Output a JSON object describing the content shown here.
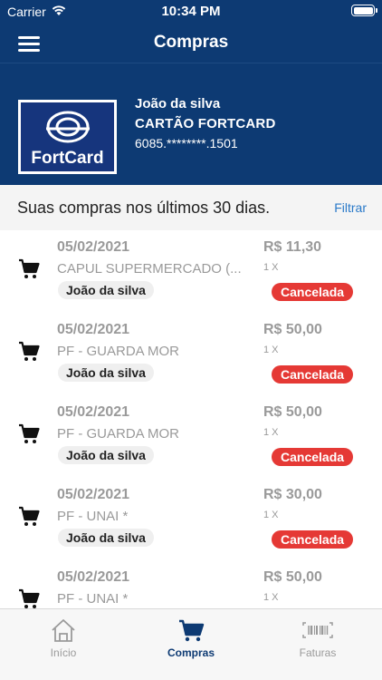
{
  "status_bar": {
    "carrier": "Carrier",
    "time": "10:34 PM"
  },
  "nav": {
    "title": "Compras"
  },
  "card": {
    "logo_text": "FortCard",
    "holder": "João da silva",
    "name": "CARTÃO FORTCARD",
    "number": "6085.********.1501"
  },
  "list_header": {
    "text": "Suas compras nos últimos 30 dias.",
    "filter_label": "Filtrar"
  },
  "purchases": [
    {
      "date": "05/02/2021",
      "merchant": "CAPUL SUPERMERCADO (...",
      "holder": "João da silva",
      "amount": "R$ 11,30",
      "installments": "1 X",
      "status": "Cancelada"
    },
    {
      "date": "05/02/2021",
      "merchant": "PF - GUARDA MOR",
      "holder": "João da silva",
      "amount": "R$ 50,00",
      "installments": "1 X",
      "status": "Cancelada"
    },
    {
      "date": "05/02/2021",
      "merchant": "PF - GUARDA MOR",
      "holder": "João da silva",
      "amount": "R$ 50,00",
      "installments": "1 X",
      "status": "Cancelada"
    },
    {
      "date": "05/02/2021",
      "merchant": "PF - UNAI *",
      "holder": "João da silva",
      "amount": "R$ 30,00",
      "installments": "1 X",
      "status": "Cancelada"
    },
    {
      "date": "05/02/2021",
      "merchant": "PF - UNAI *",
      "amount": "R$ 50,00",
      "installments": "1 X"
    }
  ],
  "tabs": [
    {
      "label": "Início",
      "icon": "home-icon",
      "active": false
    },
    {
      "label": "Compras",
      "icon": "cart-icon",
      "active": true
    },
    {
      "label": "Faturas",
      "icon": "barcode-icon",
      "active": false
    }
  ],
  "colors": {
    "primary": "#0d3a73",
    "status_cancelled": "#e53935",
    "link": "#2a7ac9"
  }
}
